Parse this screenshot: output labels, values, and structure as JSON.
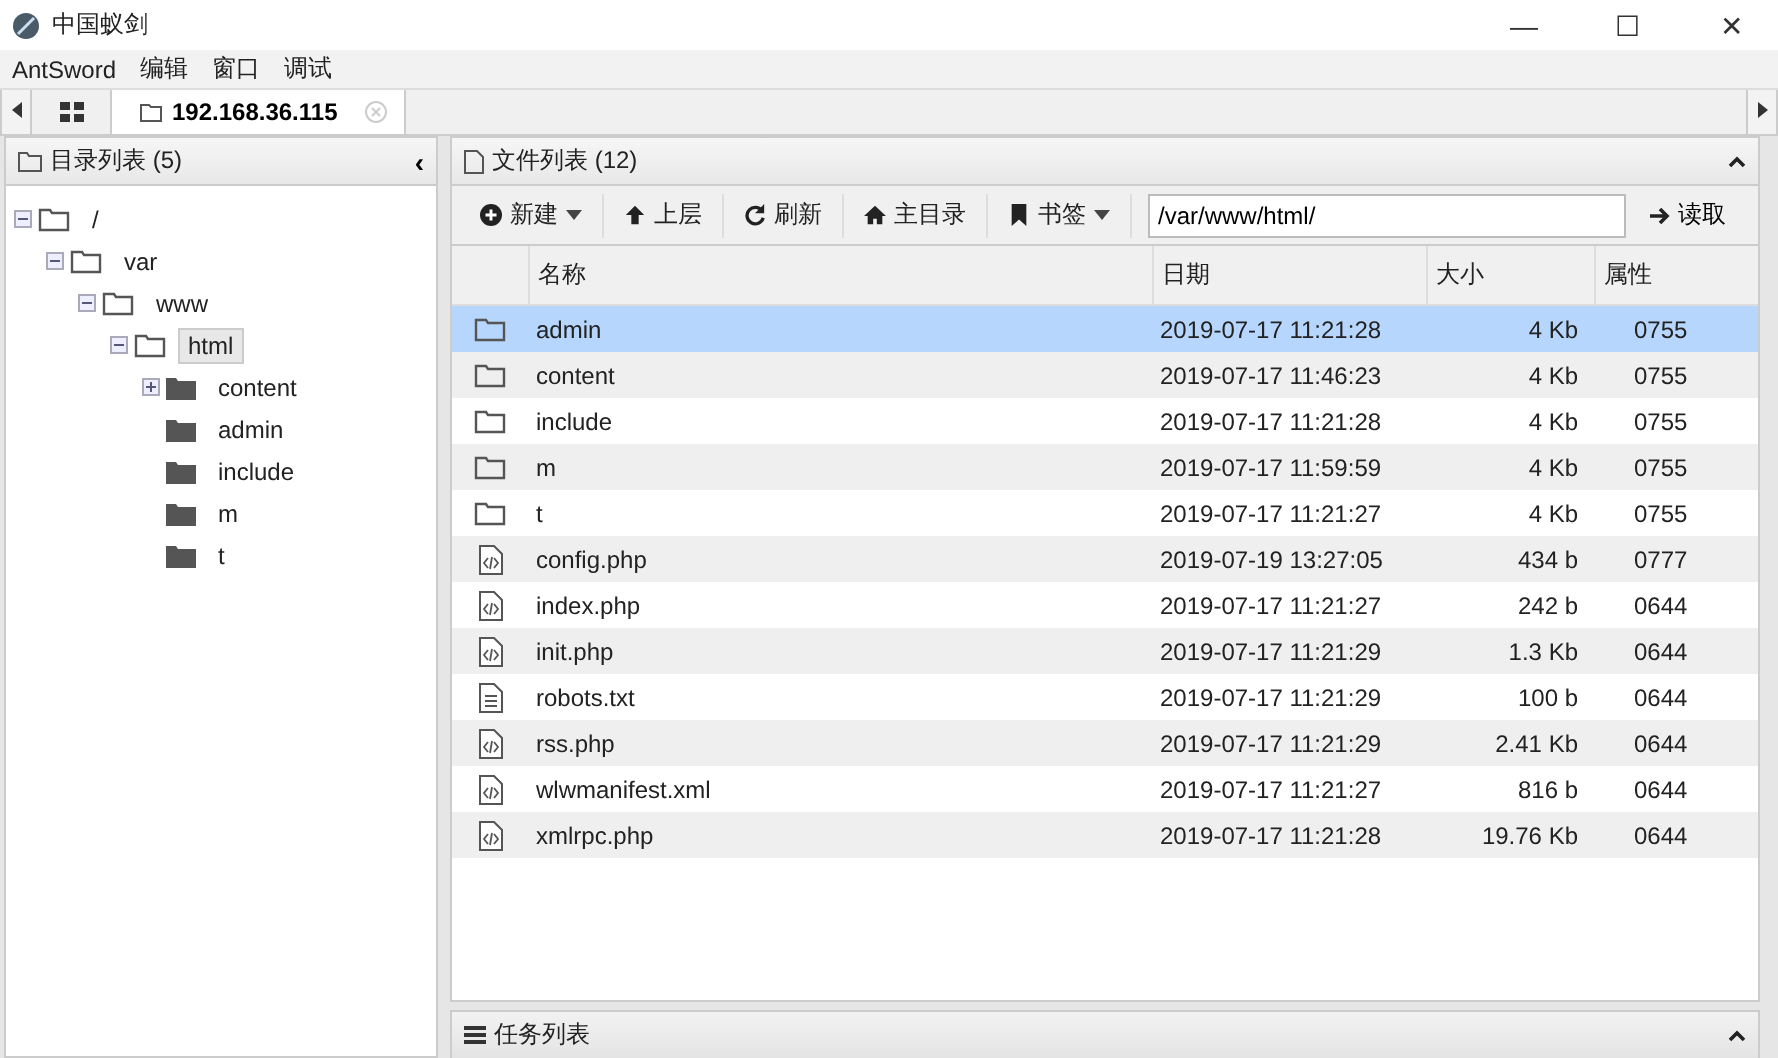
{
  "window": {
    "title": "中国蚁剑",
    "controls": [
      "—",
      "☐",
      "✕"
    ]
  },
  "menu": [
    "AntSword",
    "编辑",
    "窗口",
    "调试"
  ],
  "tabs": [
    {
      "label": "192.168.36.115",
      "selected": true
    }
  ],
  "tree_panel": {
    "title": "目录列表 (5)",
    "collapse": "‹"
  },
  "tree": [
    {
      "label": "/",
      "expanded": true,
      "expandable": true,
      "selected": false,
      "children": [
        {
          "label": "var",
          "expanded": true,
          "expandable": true,
          "selected": false,
          "children": [
            {
              "label": "www",
              "expanded": true,
              "expandable": true,
              "selected": false,
              "children": [
                {
                  "label": "html",
                  "expanded": true,
                  "expandable": true,
                  "selected": true,
                  "children": [
                    {
                      "label": "content",
                      "expanded": false,
                      "expandable": true,
                      "selected": false
                    },
                    {
                      "label": "admin",
                      "expanded": false,
                      "expandable": false,
                      "selected": false
                    },
                    {
                      "label": "include",
                      "expanded": false,
                      "expandable": false,
                      "selected": false
                    },
                    {
                      "label": "m",
                      "expanded": false,
                      "expandable": false,
                      "selected": false
                    },
                    {
                      "label": "t",
                      "expanded": false,
                      "expandable": false,
                      "selected": false
                    }
                  ]
                }
              ]
            }
          ]
        }
      ]
    }
  ],
  "file_panel": {
    "title": "文件列表 (12)"
  },
  "toolbar": [
    {
      "kind": "new",
      "label": "新建",
      "dropdown": true
    },
    {
      "kind": "up",
      "label": "上层",
      "dropdown": false
    },
    {
      "kind": "refresh",
      "label": "刷新",
      "dropdown": false
    },
    {
      "kind": "home",
      "label": "主目录",
      "dropdown": false
    },
    {
      "kind": "bookmark",
      "label": "书签",
      "dropdown": true
    }
  ],
  "path": {
    "value": "/var/www/html/"
  },
  "read_button": "读取",
  "table": {
    "columns": [
      "名称",
      "日期",
      "大小",
      "属性"
    ],
    "rows": [
      {
        "kind": "folder",
        "name": "admin",
        "date": "2019-07-17 11:21:28",
        "size": "4 Kb",
        "mode": "0755",
        "selected": true
      },
      {
        "kind": "folder",
        "name": "content",
        "date": "2019-07-17 11:46:23",
        "size": "4 Kb",
        "mode": "0755",
        "selected": false
      },
      {
        "kind": "folder",
        "name": "include",
        "date": "2019-07-17 11:21:28",
        "size": "4 Kb",
        "mode": "0755",
        "selected": false
      },
      {
        "kind": "folder",
        "name": "m",
        "date": "2019-07-17 11:59:59",
        "size": "4 Kb",
        "mode": "0755",
        "selected": false
      },
      {
        "kind": "folder",
        "name": "t",
        "date": "2019-07-17 11:21:27",
        "size": "4 Kb",
        "mode": "0755",
        "selected": false
      },
      {
        "kind": "code",
        "name": "config.php",
        "date": "2019-07-19 13:27:05",
        "size": "434 b",
        "mode": "0777",
        "selected": false
      },
      {
        "kind": "code",
        "name": "index.php",
        "date": "2019-07-17 11:21:27",
        "size": "242 b",
        "mode": "0644",
        "selected": false
      },
      {
        "kind": "code",
        "name": "init.php",
        "date": "2019-07-17 11:21:29",
        "size": "1.3 Kb",
        "mode": "0644",
        "selected": false
      },
      {
        "kind": "text",
        "name": "robots.txt",
        "date": "2019-07-17 11:21:29",
        "size": "100 b",
        "mode": "0644",
        "selected": false
      },
      {
        "kind": "code",
        "name": "rss.php",
        "date": "2019-07-17 11:21:29",
        "size": "2.41 Kb",
        "mode": "0644",
        "selected": false
      },
      {
        "kind": "code",
        "name": "wlwmanifest.xml",
        "date": "2019-07-17 11:21:27",
        "size": "816 b",
        "mode": "0644",
        "selected": false
      },
      {
        "kind": "code",
        "name": "xmlrpc.php",
        "date": "2019-07-17 11:21:28",
        "size": "19.76 Kb",
        "mode": "0644",
        "selected": false
      }
    ]
  },
  "task_panel": {
    "title": "任务列表"
  }
}
